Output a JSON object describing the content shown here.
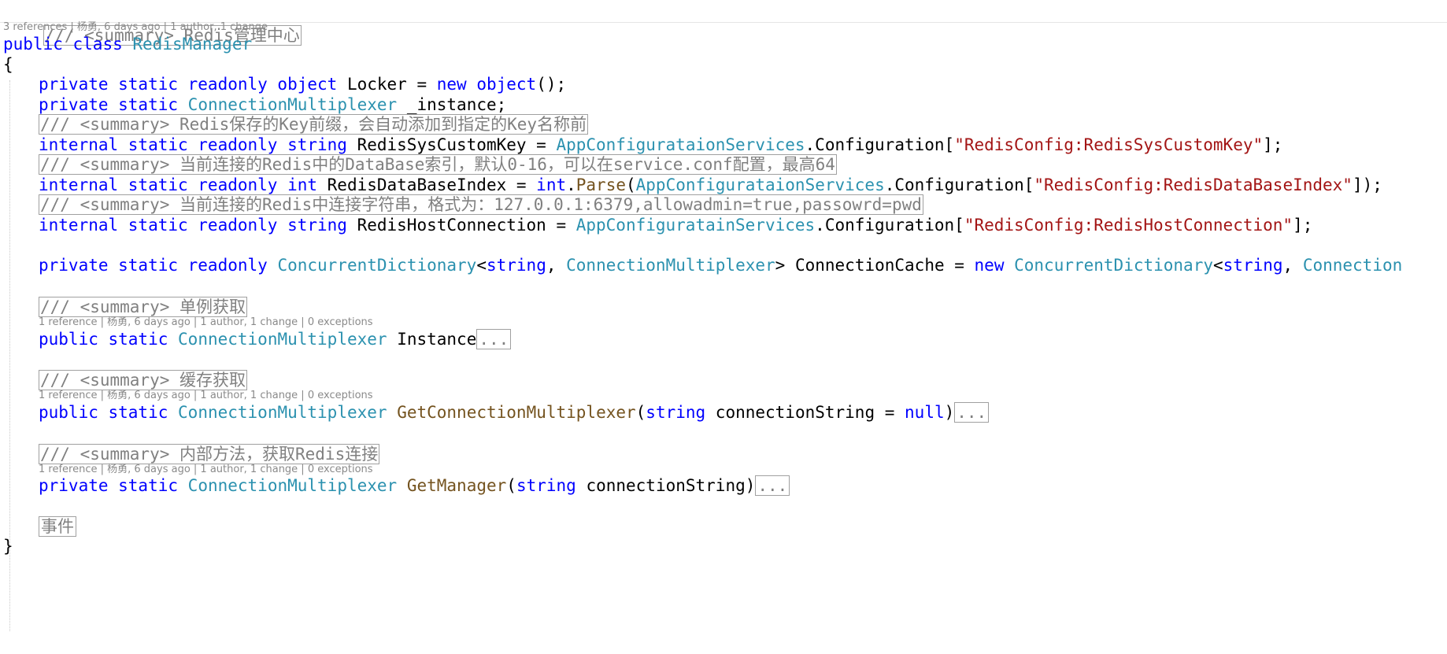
{
  "code": {
    "l1_comment": "/// <summary> Redis管理中心",
    "lens_class": "3 references | 杨勇, 6 days ago | 1 author, 1 change",
    "l2": {
      "kw1": "public",
      "kw2": "class",
      "class_name": "RedisManager"
    },
    "open_brace": "{",
    "l4": {
      "kw": "private static readonly object",
      "name": " Locker = ",
      "kw_new": "new",
      "kw_obj": "object",
      "tail": "();"
    },
    "l5": {
      "kw": "private static",
      "type": "ConnectionMultiplexer",
      "name": " _instance;"
    },
    "l6_comment": "/// <summary> Redis保存的Key前缀，会自动添加到指定的Key名称前",
    "l7": {
      "kw": "internal static readonly string",
      "name": " RedisSysCustomKey = ",
      "type": "AppConfigurataionServices",
      "mid": ".Configuration[",
      "str": "\"RedisConfig:RedisSysCustomKey\"",
      "tail": "];"
    },
    "l8_comment": "/// <summary> 当前连接的Redis中的DataBase索引，默认0-16，可以在service.conf配置，最高64",
    "l9": {
      "kw": "internal static readonly int",
      "name": " RedisDataBaseIndex = ",
      "kw_int": "int",
      "dot": ".",
      "method": "Parse",
      "paren": "(",
      "type": "AppConfigurataionServices",
      "mid": ".Configuration[",
      "str": "\"RedisConfig:RedisDataBaseIndex\"",
      "tail": "]);"
    },
    "l10_comment": "/// <summary> 当前连接的Redis中连接字符串，格式为：127.0.0.1:6379,allowadmin=true,passowrd=pwd",
    "l11": {
      "kw": "internal static readonly string",
      "name": " RedisHostConnection = ",
      "type": "AppConfiguratainServices",
      "mid": ".Configuration[",
      "str": "\"RedisConfig:RedisHostConnection\"",
      "tail": "];"
    },
    "l13": {
      "kw": "private static readonly",
      "type1": "ConcurrentDictionary",
      "lt": "<",
      "kw_s": "string",
      "comma": ", ",
      "type2": "ConnectionMultiplexer",
      "gt": ">",
      "name": " ConnectionCache = ",
      "kw_new": "new",
      "type3": "ConcurrentDictionary",
      "lt2": "<",
      "kw_s2": "string",
      "comma2": ", ",
      "type4": "Connection"
    },
    "l15_comment": "/// <summary> 单例获取",
    "lens_instance": "1 reference | 杨勇, 6 days ago | 1 author, 1 change | 0 exceptions",
    "l16": {
      "kw": "public static",
      "type": "ConnectionMultiplexer",
      "name": " Instance",
      "collapsed": "..."
    },
    "l18_comment": "/// <summary> 缓存获取",
    "lens_getconn": "1 reference | 杨勇, 6 days ago | 1 author, 1 change | 0 exceptions",
    "l19": {
      "kw": "public static",
      "type": "ConnectionMultiplexer",
      "method": "GetConnectionMultiplexer",
      "paren": "(",
      "kw_s": "string",
      "param": " connectionString",
      "eq": " = ",
      "kw_null": "null",
      "close": ")",
      "collapsed": "..."
    },
    "l21_comment": "/// <summary> 内部方法，获取Redis连接",
    "lens_getmgr": "1 reference | 杨勇, 6 days ago | 1 author, 1 change | 0 exceptions",
    "l22": {
      "kw": "private static",
      "type": "ConnectionMultiplexer",
      "method": "GetManager",
      "paren": "(",
      "kw_s": "string",
      "param": " connectionString",
      "close": ")",
      "collapsed": "..."
    },
    "l24_region": "事件",
    "close_brace": "}"
  }
}
